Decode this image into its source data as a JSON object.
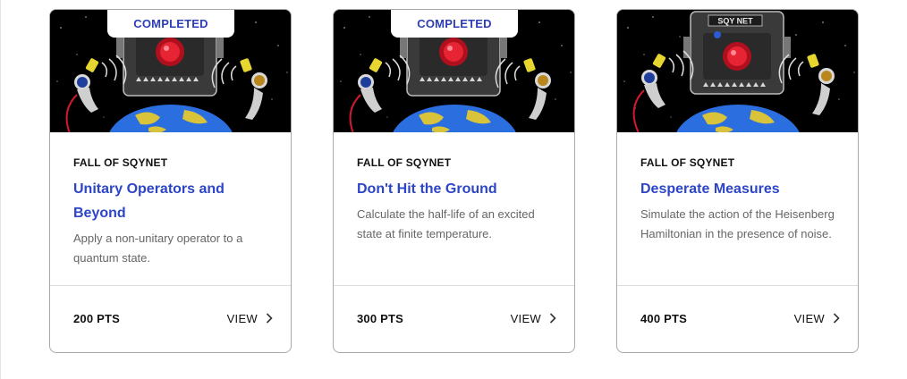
{
  "cards": [
    {
      "badge": "COMPLETED",
      "series": "FALL OF SQYNET",
      "title": "Unitary Operators and Beyond",
      "description": "Apply a non-unitary operator to a quantum state.",
      "points": "200 PTS",
      "view_label": "VIEW",
      "art": "robot-astronauts-earth"
    },
    {
      "badge": "COMPLETED",
      "series": "FALL OF SQYNET",
      "title": "Don't Hit the Ground",
      "description": "Calculate the half-life of an excited state at finite temperature.",
      "points": "300 PTS",
      "view_label": "VIEW",
      "art": "robot-astronauts-earth"
    },
    {
      "series": "FALL OF SQYNET",
      "title": "Desperate Measures",
      "description": "Simulate the action of the Heisenberg Hamiltonian in the presence of noise.",
      "points": "400 PTS",
      "view_label": "VIEW",
      "art": "robot-astronauts-earth",
      "robot_label": "SQY NET"
    }
  ],
  "colors": {
    "accent": "#2d45c7",
    "badge_text": "#2d3eb5",
    "border": "#a9a9a9"
  },
  "icons": {
    "view": "chevron-right-icon"
  }
}
